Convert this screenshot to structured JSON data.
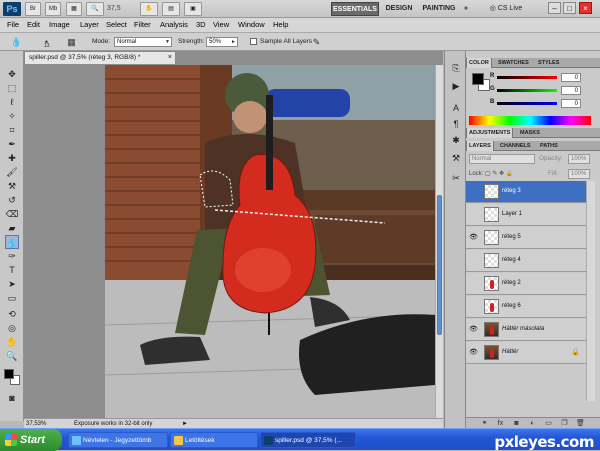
{
  "appbar": {
    "logo": "Ps",
    "btn_br": "Br",
    "btn_mb": "Mb",
    "zoom": "37,5",
    "workspaces": [
      "ESSENTIALS",
      "DESIGN",
      "PAINTING"
    ],
    "more": "»",
    "cslive": "CS Live",
    "win_min": "–",
    "win_max": "□",
    "win_close": "×"
  },
  "menubar": [
    "File",
    "Edit",
    "Image",
    "Layer",
    "Select",
    "Filter",
    "Analysis",
    "3D",
    "View",
    "Window",
    "Help"
  ],
  "options": {
    "brush_size": "13",
    "mode_label": "Mode:",
    "mode_value": "Normal",
    "strength_label": "Strength:",
    "strength_value": "50%",
    "sample_all": "Sample All Layers"
  },
  "document": {
    "tab_title": "spiller.psd @ 37,5% (réteg 3, RGB/8) *",
    "close": "×"
  },
  "status": {
    "zoom": "37,53%",
    "message": "Exposure works in 32-bit only",
    "arrow": "►"
  },
  "color_panel": {
    "tabs": [
      "COLOR",
      "SWATCHES",
      "STYLES"
    ],
    "channels": [
      {
        "label": "R",
        "value": "0",
        "color": "#c00000"
      },
      {
        "label": "G",
        "value": "0",
        "color": "#00a000"
      },
      {
        "label": "B",
        "value": "0",
        "color": "#0000c0"
      }
    ]
  },
  "adjust_panel": {
    "tabs": [
      "ADJUSTMENTS",
      "MASKS"
    ]
  },
  "layers_panel": {
    "tabs": [
      "LAYERS",
      "CHANNELS",
      "PATHS"
    ],
    "blend_mode": "Normal",
    "opacity_label": "Opacity:",
    "opacity_value": "100%",
    "lock_label": "Lock:",
    "fill_label": "Fill:",
    "fill_value": "100%",
    "layers": [
      {
        "name": "réteg 3",
        "visible": false,
        "selected": true,
        "thumb": "transparent"
      },
      {
        "name": "Layer 1",
        "visible": false,
        "selected": false,
        "thumb": "transparent"
      },
      {
        "name": "réteg 5",
        "visible": true,
        "selected": false,
        "thumb": "transparent"
      },
      {
        "name": "réteg 4",
        "visible": false,
        "selected": false,
        "thumb": "transparent"
      },
      {
        "name": "réteg 2",
        "visible": false,
        "selected": false,
        "thumb": "cello"
      },
      {
        "name": "réteg 6",
        "visible": false,
        "selected": false,
        "thumb": "cello"
      },
      {
        "name": "Háttér másolata",
        "visible": true,
        "selected": false,
        "thumb": "photo"
      },
      {
        "name": "Háttér",
        "visible": true,
        "selected": false,
        "thumb": "photo",
        "locked": true
      }
    ]
  },
  "taskbar": {
    "start": "Start",
    "items": [
      {
        "label": "Névtelen - Jegyzettömb",
        "icon_color": "#6fc0ff"
      },
      {
        "label": "Letöltések",
        "icon_color": "#f2c94c"
      },
      {
        "label": "spiller.psd @ 37,5% (...",
        "icon_color": "#0d3f6e"
      }
    ]
  },
  "watermark": "pxleyes.com"
}
